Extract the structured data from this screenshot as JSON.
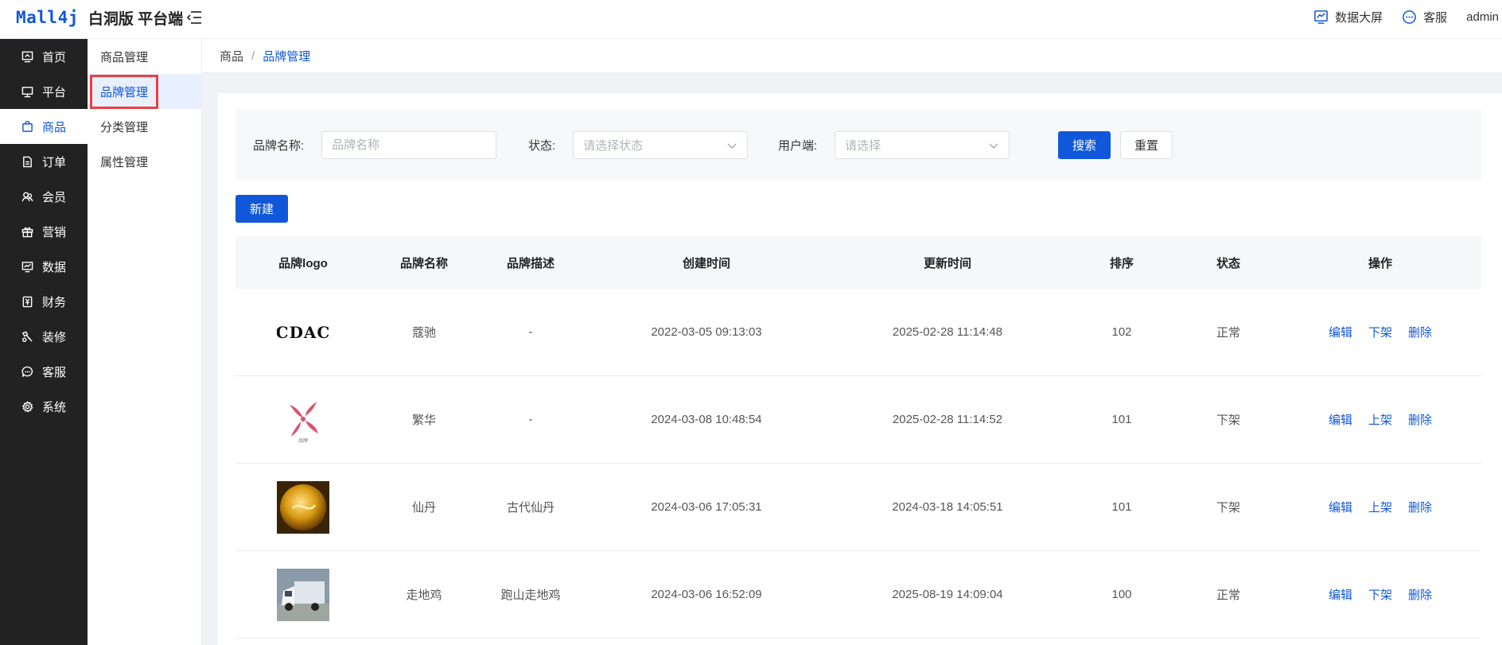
{
  "header": {
    "logo_mark": "Mall4j",
    "logo_text": "白洞版 平台端",
    "links": [
      {
        "label": "数据大屏",
        "icon": "dashboard-icon"
      },
      {
        "label": "客服",
        "icon": "chat-icon"
      }
    ],
    "user": "admin"
  },
  "sidebar": {
    "items": [
      {
        "label": "首页",
        "icon": "home-icon"
      },
      {
        "label": "平台",
        "icon": "platform-icon"
      },
      {
        "label": "商品",
        "icon": "goods-icon",
        "active": true
      },
      {
        "label": "订单",
        "icon": "order-icon"
      },
      {
        "label": "会员",
        "icon": "member-icon"
      },
      {
        "label": "营销",
        "icon": "gift-icon"
      },
      {
        "label": "数据",
        "icon": "data-icon"
      },
      {
        "label": "财务",
        "icon": "finance-icon"
      },
      {
        "label": "装修",
        "icon": "decorate-icon"
      },
      {
        "label": "客服",
        "icon": "service-icon"
      },
      {
        "label": "系统",
        "icon": "gear-icon"
      }
    ]
  },
  "subnav": {
    "items": [
      {
        "label": "商品管理"
      },
      {
        "label": "品牌管理",
        "active": true
      },
      {
        "label": "分类管理"
      },
      {
        "label": "属性管理"
      }
    ]
  },
  "breadcrumb": {
    "parent": "商品",
    "separator": "/",
    "current": "品牌管理"
  },
  "search": {
    "brand_label": "品牌名称:",
    "brand_placeholder": "品牌名称",
    "status_label": "状态:",
    "status_placeholder": "请选择状态",
    "client_label": "用户端:",
    "client_placeholder": "请选择",
    "search_button": "搜索",
    "reset_button": "重置"
  },
  "new_button": "新建",
  "table": {
    "columns": [
      "品牌logo",
      "品牌名称",
      "品牌描述",
      "创建时间",
      "更新时间",
      "排序",
      "状态",
      "操作"
    ],
    "rows": [
      {
        "name": "蔻驰",
        "desc": "-",
        "created": "2022-03-05 09:13:03",
        "updated": "2025-02-28 11:14:48",
        "sort": "102",
        "status": "正常",
        "ops": [
          "编辑",
          "下架",
          "删除"
        ],
        "logo": "coach-logo"
      },
      {
        "name": "繁华",
        "desc": "-",
        "created": "2024-03-08 10:48:54",
        "updated": "2025-02-28 11:14:52",
        "sort": "101",
        "status": "下架",
        "ops": [
          "编辑",
          "上架",
          "删除"
        ],
        "logo": "pinwheel-logo"
      },
      {
        "name": "仙丹",
        "desc": "古代仙丹",
        "created": "2024-03-06 17:05:31",
        "updated": "2024-03-18 14:05:51",
        "sort": "101",
        "status": "下架",
        "ops": [
          "编辑",
          "上架",
          "删除"
        ],
        "logo": "golden-orb-logo"
      },
      {
        "name": "走地鸡",
        "desc": "跑山走地鸡",
        "created": "2024-03-06 16:52:09",
        "updated": "2025-08-19 14:09:04",
        "sort": "100",
        "status": "正常",
        "ops": [
          "编辑",
          "下架",
          "删除"
        ],
        "logo": "truck-photo-logo"
      }
    ]
  },
  "colors": {
    "accent": "#1157d9",
    "sidebar": "#222222",
    "highlight_border": "#e8413f"
  }
}
